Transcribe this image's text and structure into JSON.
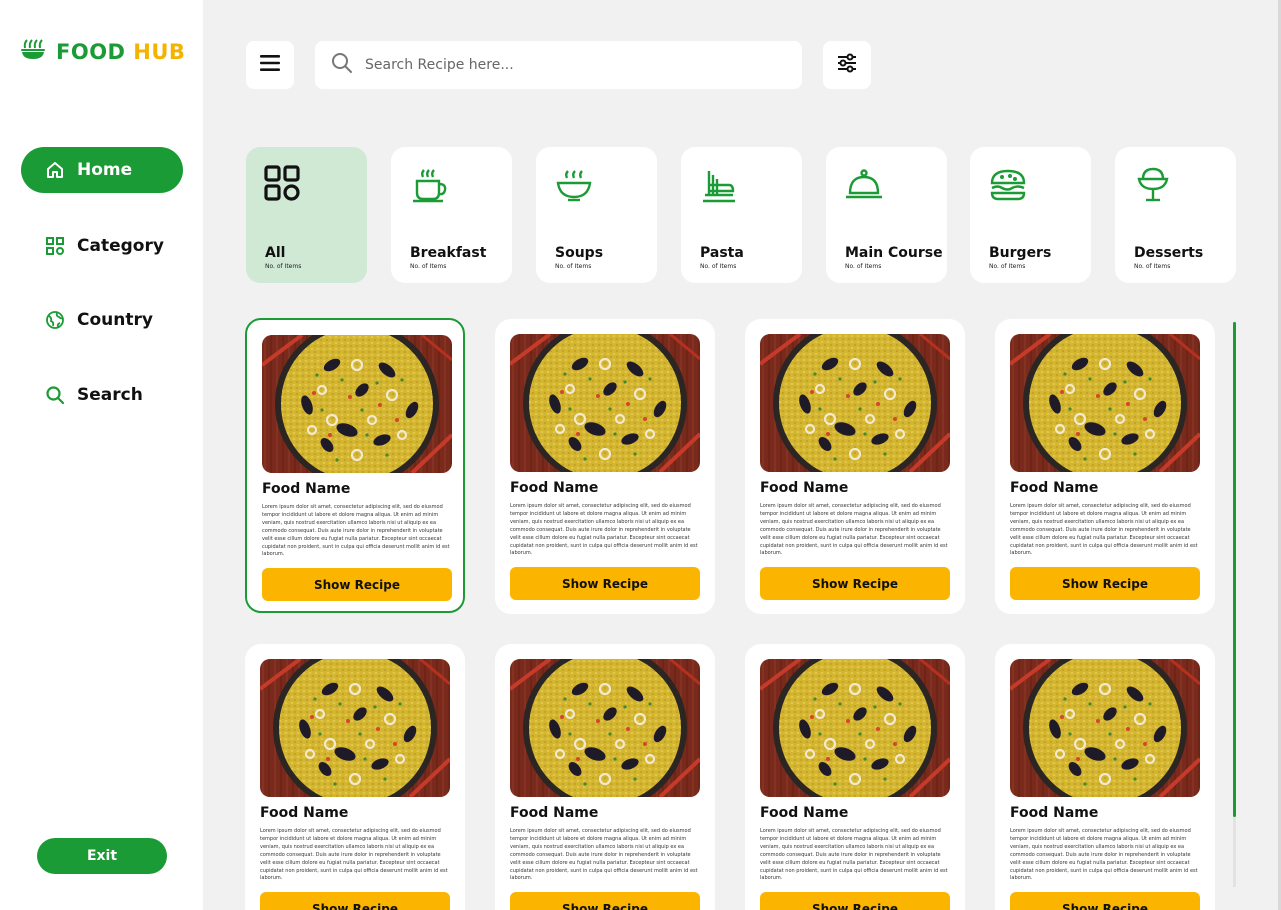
{
  "brand": {
    "part1": "FOOD",
    "part2": "HUB",
    "green": "#1a9b35",
    "yellow": "#f3b300"
  },
  "nav": [
    {
      "label": "Home",
      "icon": "home-icon",
      "active": true
    },
    {
      "label": "Category",
      "icon": "grid-icon",
      "active": false
    },
    {
      "label": "Country",
      "icon": "globe-icon",
      "active": false
    },
    {
      "label": "Search",
      "icon": "search-icon",
      "active": false
    }
  ],
  "exit_label": "Exit",
  "search": {
    "placeholder": "Search Recipe here..."
  },
  "categories": [
    {
      "name": "All",
      "count": "No. of Items",
      "icon": "grid-icon",
      "active": true
    },
    {
      "name": "Breakfast",
      "count": "No. of Items",
      "icon": "coffee-cup-icon",
      "active": false
    },
    {
      "name": "Soups",
      "count": "No. of Items",
      "icon": "soup-bowl-icon",
      "active": false
    },
    {
      "name": "Pasta",
      "count": "No. of Items",
      "icon": "pasta-icon",
      "active": false
    },
    {
      "name": "Main Course",
      "count": "No. of Items",
      "icon": "cloche-icon",
      "active": false
    },
    {
      "name": "Burgers",
      "count": "No. of Items",
      "icon": "burger-icon",
      "active": false
    },
    {
      "name": "Desserts",
      "count": "No. of Items",
      "icon": "ice-cream-icon",
      "active": false
    }
  ],
  "foods": [
    {
      "name": "Food Name",
      "desc": "Lorem ipsum dolor sit amet, consectetur adipiscing elit, sed do eiusmod tempor incididunt ut labore et dolore magna aliqua. Ut enim ad minim veniam, quis nostrud exercitation ullamco laboris nisi ut aliquip ex ea commodo consequat. Duis aute irure dolor in reprehenderit in voluptate velit esse cillum dolore eu fugiat nulla pariatur. Excepteur sint occaecat cupidatat non proident, sunt in culpa qui officia deserunt mollit anim id est laborum.",
      "button": "Show Recipe",
      "selected": true
    },
    {
      "name": "Food Name",
      "desc": "Lorem ipsum dolor sit amet, consectetur adipiscing elit, sed do eiusmod tempor incididunt ut labore et dolore magna aliqua. Ut enim ad minim veniam, quis nostrud exercitation ullamco laboris nisi ut aliquip ex ea commodo consequat. Duis aute irure dolor in reprehenderit in voluptate velit esse cillum dolore eu fugiat nulla pariatur. Excepteur sint occaecat cupidatat non proident, sunt in culpa qui officia deserunt mollit anim id est laborum.",
      "button": "Show Recipe",
      "selected": false
    },
    {
      "name": "Food Name",
      "desc": "Lorem ipsum dolor sit amet, consectetur adipiscing elit, sed do eiusmod tempor incididunt ut labore et dolore magna aliqua. Ut enim ad minim veniam, quis nostrud exercitation ullamco laboris nisi ut aliquip ex ea commodo consequat. Duis aute irure dolor in reprehenderit in voluptate velit esse cillum dolore eu fugiat nulla pariatur. Excepteur sint occaecat cupidatat non proident, sunt in culpa qui officia deserunt mollit anim id est laborum.",
      "button": "Show Recipe",
      "selected": false
    },
    {
      "name": "Food Name",
      "desc": "Lorem ipsum dolor sit amet, consectetur adipiscing elit, sed do eiusmod tempor incididunt ut labore et dolore magna aliqua. Ut enim ad minim veniam, quis nostrud exercitation ullamco laboris nisi ut aliquip ex ea commodo consequat. Duis aute irure dolor in reprehenderit in voluptate velit esse cillum dolore eu fugiat nulla pariatur. Excepteur sint occaecat cupidatat non proident, sunt in culpa qui officia deserunt mollit anim id est laborum.",
      "button": "Show Recipe",
      "selected": false
    },
    {
      "name": "Food Name",
      "desc": "Lorem ipsum dolor sit amet, consectetur adipiscing elit, sed do eiusmod tempor incididunt ut labore et dolore magna aliqua. Ut enim ad minim veniam, quis nostrud exercitation ullamco laboris nisi ut aliquip ex ea commodo consequat. Duis aute irure dolor in reprehenderit in voluptate velit esse cillum dolore eu fugiat nulla pariatur. Excepteur sint occaecat cupidatat non proident, sunt in culpa qui officia deserunt mollit anim id est laborum.",
      "button": "Show Recipe",
      "selected": false
    },
    {
      "name": "Food Name",
      "desc": "Lorem ipsum dolor sit amet, consectetur adipiscing elit, sed do eiusmod tempor incididunt ut labore et dolore magna aliqua. Ut enim ad minim veniam, quis nostrud exercitation ullamco laboris nisi ut aliquip ex ea commodo consequat. Duis aute irure dolor in reprehenderit in voluptate velit esse cillum dolore eu fugiat nulla pariatur. Excepteur sint occaecat cupidatat non proident, sunt in culpa qui officia deserunt mollit anim id est laborum.",
      "button": "Show Recipe",
      "selected": false
    },
    {
      "name": "Food Name",
      "desc": "Lorem ipsum dolor sit amet, consectetur adipiscing elit, sed do eiusmod tempor incididunt ut labore et dolore magna aliqua. Ut enim ad minim veniam, quis nostrud exercitation ullamco laboris nisi ut aliquip ex ea commodo consequat. Duis aute irure dolor in reprehenderit in voluptate velit esse cillum dolore eu fugiat nulla pariatur. Excepteur sint occaecat cupidatat non proident, sunt in culpa qui officia deserunt mollit anim id est laborum.",
      "button": "Show Recipe",
      "selected": false
    },
    {
      "name": "Food Name",
      "desc": "Lorem ipsum dolor sit amet, consectetur adipiscing elit, sed do eiusmod tempor incididunt ut labore et dolore magna aliqua. Ut enim ad minim veniam, quis nostrud exercitation ullamco laboris nisi ut aliquip ex ea commodo consequat. Duis aute irure dolor in reprehenderit in voluptate velit esse cillum dolore eu fugiat nulla pariatur. Excepteur sint occaecat cupidatat non proident, sunt in culpa qui officia deserunt mollit anim id est laborum.",
      "button": "Show Recipe",
      "selected": false
    }
  ],
  "colors": {
    "accent": "#1a9b35",
    "button": "#fbb400",
    "active_category": "#cfe9d5",
    "background": "#f1f1f1"
  }
}
